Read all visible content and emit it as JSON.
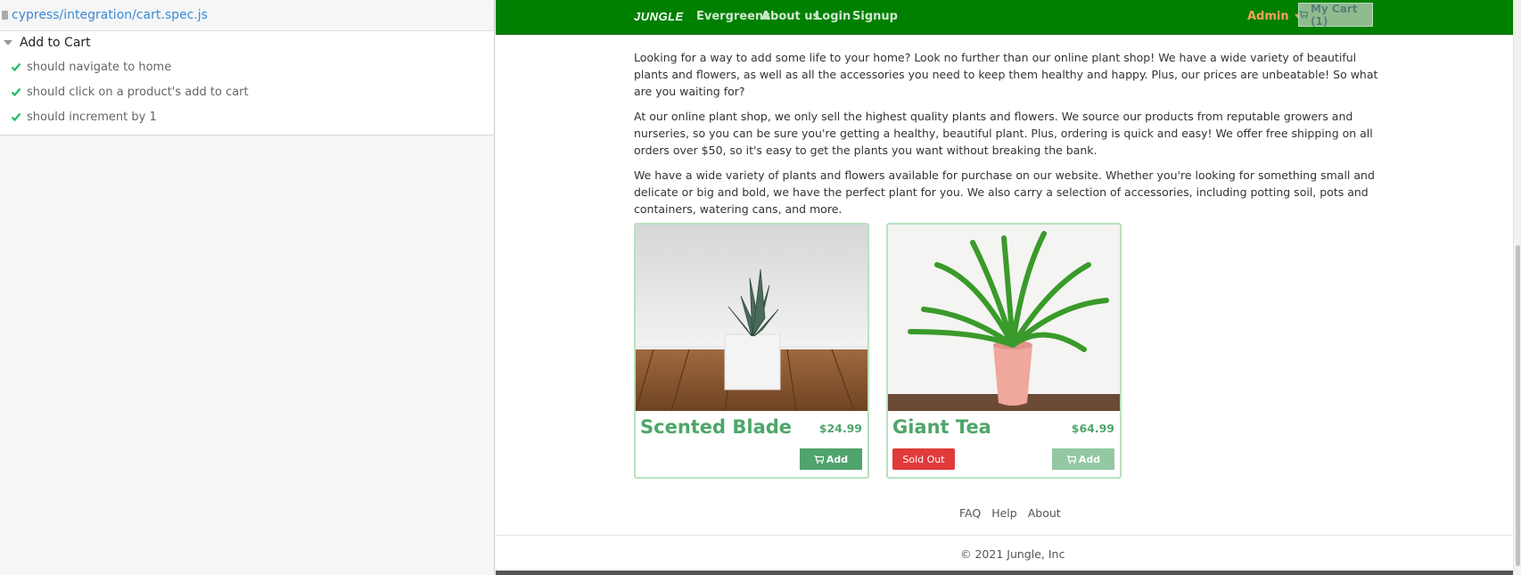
{
  "reporter": {
    "spec_path": "cypress/integration/cart.spec.js",
    "suite_title": "Add to Cart",
    "tests": [
      {
        "label": "should navigate to home",
        "status": "passed"
      },
      {
        "label": "should click on a product's add to cart",
        "status": "passed"
      },
      {
        "label": "should increment by 1",
        "status": "passed"
      }
    ],
    "pass_color": "#1abc63"
  },
  "navbar": {
    "brand": "JUNGLE",
    "links": [
      "Evergreens",
      "About us",
      "Login",
      "Signup"
    ],
    "admin": "Admin",
    "cart": "My Cart (1)",
    "bg_color": "#008000"
  },
  "intro": {
    "paragraphs": [
      "Looking for a way to add some life to your home? Look no further than our online plant shop! We have a wide variety of beautiful plants and flowers, as well as all the accessories you need to keep them healthy and happy. Plus, our prices are unbeatable! So what are you waiting for?",
      "At our online plant shop, we only sell the highest quality plants and flowers. We source our products from reputable growers and nurseries, so you can be sure you're getting a healthy, beautiful plant. Plus, ordering is quick and easy! We offer free shipping on all orders over $50, so it's easy to get the plants you want without breaking the bank.",
      "We have a wide variety of plants and flowers available for purchase on our website. Whether you're looking for something small and delicate or big and bold, we have the perfect plant for you. We also carry a selection of accessories, including potting soil, pots and containers, watering cans, and more."
    ]
  },
  "products": [
    {
      "name": "Scented Blade",
      "price": "$24.99",
      "add_label": "Add",
      "sold_out": false
    },
    {
      "name": "Giant Tea",
      "price": "$64.99",
      "add_label": "Add",
      "sold_out": true,
      "sold_out_label": "Sold Out"
    }
  ],
  "footer": {
    "links": [
      "FAQ",
      "Help",
      "About"
    ],
    "copyright": "© 2021 Jungle, Inc"
  }
}
